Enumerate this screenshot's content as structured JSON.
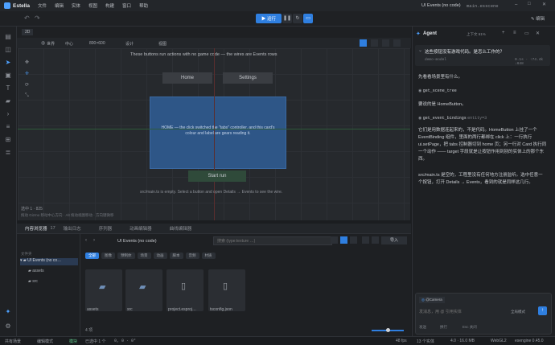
{
  "menubar": {
    "app_name": "Estella",
    "items": [
      "文件",
      "编辑",
      "实体",
      "视图",
      "构建",
      "窗口",
      "帮助"
    ],
    "window_title": "UI Events (no code)",
    "file_name": "main.esscene"
  },
  "toolbar": {
    "run_label": "▶ 运行",
    "edit_label": "编辑"
  },
  "viewport": {
    "tab_label": "2D",
    "mode_world": "世界",
    "mode_center": "中心",
    "resolution": "800×600",
    "design": "设计",
    "mode_label": "视图",
    "hint": "These buttons run actions with no game code — the wires are Events rows",
    "home_btn": "Home",
    "settings_btn": "Settings",
    "card_text": "HOME — the click switched the \"tabs\" controller, and this card's colour and label are gears reading it.",
    "start_btn": "Start run",
    "footer_hint": "src/main.ts is empty. Select a button and open Details → Events to see the wire.",
    "sel_count": "选中 1 · 825",
    "drag_hint": "拖动 Gizmo 移动中心方向 · Alt 拖动视图移动 · 方向键微移"
  },
  "bottom_tabs": [
    "内容浏览器",
    "输出日志",
    "序列器",
    "动画编辑器",
    "曲线编辑器"
  ],
  "bottom_tab_counts": {
    "content": "17"
  },
  "content": {
    "path": "UI Events (no code)",
    "search_placeholder": "搜索 (type:texture …)",
    "import_label": "导入",
    "folders_label": "文件夹",
    "tree": [
      "UI Events (no co…",
      "assets",
      "src"
    ],
    "filters": [
      "全部",
      "图像",
      "预制体",
      "场景",
      "动画",
      "脚本",
      "音频",
      "材质"
    ],
    "files": [
      {
        "name": "assets",
        "type": "folder"
      },
      {
        "name": "src",
        "type": "folder"
      },
      {
        "name": "project.esproj…",
        "type": "file"
      },
      {
        "name": "tsconfig.json",
        "type": "file"
      }
    ],
    "count": "4 项"
  },
  "agent": {
    "title": "Agent",
    "context": "上下文 61%",
    "question": "这些按钮没有游戏代码。是怎么工作的？",
    "model": "demo-model",
    "usage": "0.1s · ↑74.4k ↓648",
    "msg1": "先看看场景里有什么。",
    "tool1": "get_scene_tree",
    "tool1_sub": "",
    "msg2": "要说的是 HomeButton。",
    "tool2": "get_event_bindings",
    "tool2_sub": "entity=3",
    "msg3": "它们是用数据连起来的，不是代码。HomeButton 上挂了一个 EventBinding 组件，里面的两行都绑在 click 上：一行执行 ui.setPage，把 tabs 控制器切到 home 页；另一行对 Card 执行同一个动作 —— target 字段就是让按钮作用到别的实体上的那个东西。",
    "msg4": "src/main.ts 是空的，工程里没有任何地方注册监听。选中任意一个按钮，打开 Details → Events，看到的就是同样这几行。",
    "mention": "@Camera",
    "input_placeholder": "发消息，用 @ 引用实体",
    "auto_label": "全局模式",
    "hint_send": "发送",
    "hint_newline": "换行",
    "hint_stop": "Esc 关闭"
  },
  "statusbar": {
    "left1": "共有场景",
    "left2": "编辑模式",
    "left3": "模块",
    "sel": "已选中 1 个",
    "coords": "0, 0 · 0°",
    "fps": "48 fps",
    "entities": "13 个实体",
    "version": "4.0 · 16.0 MB",
    "gl": "WebGL2",
    "engine": "esengine 0.45.0"
  },
  "colors": {
    "accent": "#2f7fe0",
    "bg": "#1b1d20",
    "card": "#2f5a8f"
  }
}
